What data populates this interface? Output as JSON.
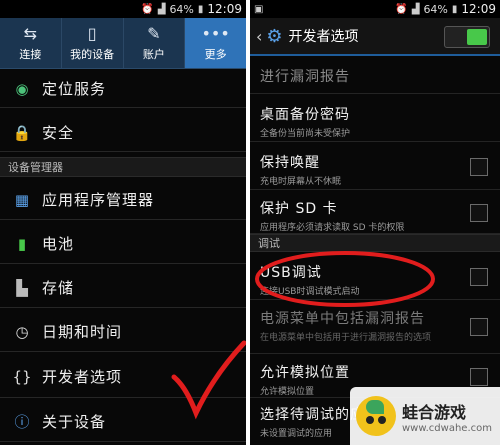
{
  "left": {
    "status": {
      "battery": "64%",
      "time": "12:09"
    },
    "tabs": [
      {
        "label": "连接",
        "icon": "wifi-connect-icon",
        "glyph": "⇆"
      },
      {
        "label": "我的设备",
        "icon": "device-icon",
        "glyph": "▯"
      },
      {
        "label": "账户",
        "icon": "key-icon",
        "glyph": "✎"
      },
      {
        "label": "更多",
        "icon": "more-icon",
        "glyph": "•••"
      }
    ],
    "items": {
      "location": "定位服务",
      "security": "安全",
      "section": "设备管理器",
      "apps": "应用程序管理器",
      "battery": "电池",
      "storage": "存储",
      "datetime": "日期和时间",
      "developer": "开发者选项",
      "about": "关于设备"
    }
  },
  "right": {
    "status": {
      "battery": "64%",
      "time": "12:09"
    },
    "title": "开发者选项",
    "options": {
      "bugreport": {
        "title": "进行漏洞报告"
      },
      "backup": {
        "title": "桌面备份密码",
        "sub": "全备份当前尚未受保护"
      },
      "stayawake": {
        "title": "保持唤醒",
        "sub": "充电时屏幕从不休眠"
      },
      "sdprotect": {
        "title": "保护 SD 卡",
        "sub": "应用程序必须请求读取 SD 卡的权限"
      },
      "section": "调试",
      "usb": {
        "title": "USB调试",
        "sub": "连接USB时调试模式启动"
      },
      "bugmenu": {
        "title": "电源菜单中包括漏洞报告",
        "sub": "在电源菜单中包括用于进行漏洞报告的选项"
      },
      "mock": {
        "title": "允许模拟位置",
        "sub": "允许模拟位置"
      },
      "debugapp": {
        "title": "选择待调试的应用",
        "sub": "未设置调试的应用"
      }
    }
  },
  "watermark": {
    "title": "蛙合游戏",
    "url": "www.cdwahe.com"
  },
  "colors": {
    "accent_green": "#48c84a",
    "tab_active": "#2f73b8",
    "annotation_red": "#e11d1d"
  }
}
